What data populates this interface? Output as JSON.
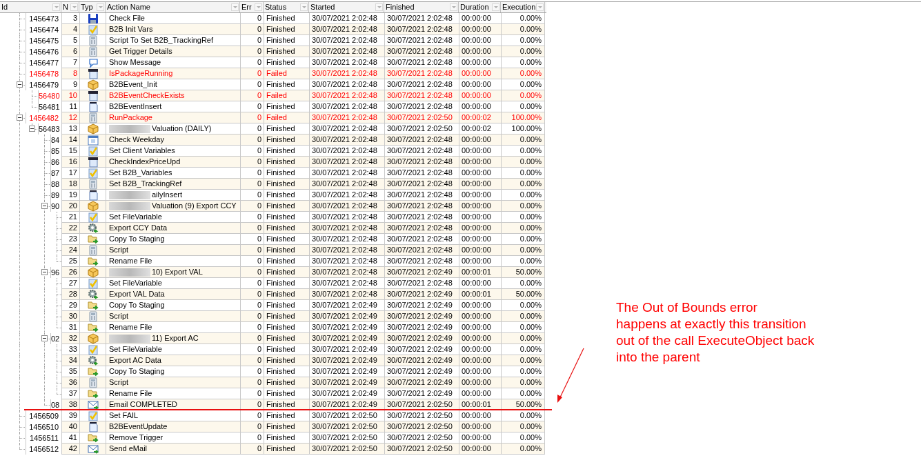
{
  "columns": [
    "Id",
    "N",
    "Typ",
    "Action Name",
    "Err",
    "Status",
    "Started",
    "Finished",
    "Duration",
    "Execution"
  ],
  "rows": [
    {
      "id": "1456473",
      "no": "3",
      "kind": "floppy",
      "name": "Check File",
      "errors": "0",
      "status": "Finished",
      "failed": false,
      "started": "30/07/2021 2:02:48",
      "finished": "30/07/2021 2:02:48",
      "duration": "00:00:00",
      "execution": "0.00%"
    },
    {
      "id": "1456474",
      "no": "4",
      "kind": "check",
      "name": "B2B Init Vars",
      "errors": "0",
      "status": "Finished",
      "failed": false,
      "started": "30/07/2021 2:02:48",
      "finished": "30/07/2021 2:02:48",
      "duration": "00:00:00",
      "execution": "0.00%"
    },
    {
      "id": "1456475",
      "no": "5",
      "kind": "calculator",
      "name": "Script To Set B2B_TrackingRef",
      "errors": "0",
      "status": "Finished",
      "failed": false,
      "started": "30/07/2021 2:02:48",
      "finished": "30/07/2021 2:02:48",
      "duration": "00:00:00",
      "execution": "0.00%"
    },
    {
      "id": "1456476",
      "no": "6",
      "kind": "calculator",
      "name": "Get Trigger Details",
      "errors": "0",
      "status": "Finished",
      "failed": false,
      "started": "30/07/2021 2:02:48",
      "finished": "30/07/2021 2:02:48",
      "duration": "00:00:00",
      "execution": "0.00%"
    },
    {
      "id": "1456477",
      "no": "7",
      "kind": "speech",
      "name": "Show Message",
      "errors": "0",
      "status": "Finished",
      "failed": false,
      "started": "30/07/2021 2:02:48",
      "finished": "30/07/2021 2:02:48",
      "duration": "00:00:00",
      "execution": "0.00%"
    },
    {
      "id": "1456478",
      "no": "8",
      "kind": "data",
      "name": "IsPackageRunning",
      "errors": "0",
      "status": "Failed",
      "failed": true,
      "started": "30/07/2021 2:02:48",
      "finished": "30/07/2021 2:02:48",
      "duration": "00:00:00",
      "execution": "0.00%"
    },
    {
      "id": "1456479",
      "no": "9",
      "kind": "box",
      "name": "B2BEvent_Init",
      "errors": "0",
      "status": "Finished",
      "failed": false,
      "started": "30/07/2021 2:02:48",
      "finished": "30/07/2021 2:02:48",
      "duration": "00:00:00",
      "execution": "0.00%",
      "expanded": true,
      "children": [
        {
          "id": "56480",
          "no": "10",
          "kind": "data",
          "name": "B2BEventCheckExists",
          "errors": "0",
          "status": "Failed",
          "failed": true,
          "started": "30/07/2021 2:02:48",
          "finished": "30/07/2021 2:02:48",
          "duration": "00:00:00",
          "execution": "0.00%"
        },
        {
          "id": "56481",
          "no": "11",
          "kind": "sql",
          "name": "B2BEventInsert",
          "errors": "0",
          "status": "Finished",
          "failed": false,
          "started": "30/07/2021 2:02:48",
          "finished": "30/07/2021 2:02:48",
          "duration": "00:00:00",
          "execution": "0.00%"
        }
      ]
    },
    {
      "id": "1456482",
      "no": "12",
      "kind": "calculator",
      "name": "RunPackage",
      "errors": "0",
      "status": "Failed",
      "failed": true,
      "started": "30/07/2021 2:02:48",
      "finished": "30/07/2021 2:02:50",
      "duration": "00:00:02",
      "execution": "100.00%",
      "expanded": true,
      "children": [
        {
          "id": "56483",
          "no": "13",
          "kind": "box",
          "name": "Valuation (DAILY)",
          "redacted": true,
          "errors": "0",
          "status": "Finished",
          "failed": false,
          "started": "30/07/2021 2:02:48",
          "finished": "30/07/2021 2:02:50",
          "duration": "00:00:02",
          "execution": "100.00%",
          "expanded": true,
          "children": [
            {
              "id": "84",
              "no": "14",
              "kind": "calendar",
              "name": "Check Weekday",
              "errors": "0",
              "status": "Finished",
              "failed": false,
              "started": "30/07/2021 2:02:48",
              "finished": "30/07/2021 2:02:48",
              "duration": "00:00:00",
              "execution": "0.00%"
            },
            {
              "id": "85",
              "no": "15",
              "kind": "check",
              "name": "Set Client Variables",
              "errors": "0",
              "status": "Finished",
              "failed": false,
              "started": "30/07/2021 2:02:48",
              "finished": "30/07/2021 2:02:48",
              "duration": "00:00:00",
              "execution": "0.00%"
            },
            {
              "id": "86",
              "no": "16",
              "kind": "data",
              "name": "CheckIndexPriceUpd",
              "errors": "0",
              "status": "Finished",
              "failed": false,
              "started": "30/07/2021 2:02:48",
              "finished": "30/07/2021 2:02:48",
              "duration": "00:00:00",
              "execution": "0.00%"
            },
            {
              "id": "87",
              "no": "17",
              "kind": "check",
              "name": "Set B2B_Variables",
              "errors": "0",
              "status": "Finished",
              "failed": false,
              "started": "30/07/2021 2:02:48",
              "finished": "30/07/2021 2:02:48",
              "duration": "00:00:00",
              "execution": "0.00%"
            },
            {
              "id": "88",
              "no": "18",
              "kind": "calculator",
              "name": "Set B2B_TrackingRef",
              "errors": "0",
              "status": "Finished",
              "failed": false,
              "started": "30/07/2021 2:02:48",
              "finished": "30/07/2021 2:02:48",
              "duration": "00:00:00",
              "execution": "0.00%"
            },
            {
              "id": "89",
              "no": "19",
              "kind": "sql",
              "name": "ailyInsert",
              "redacted": true,
              "errors": "0",
              "status": "Finished",
              "failed": false,
              "started": "30/07/2021 2:02:48",
              "finished": "30/07/2021 2:02:48",
              "duration": "00:00:00",
              "execution": "0.00%"
            },
            {
              "id": "90",
              "no": "20",
              "kind": "box",
              "name": "Valuation (9) Export CCY",
              "redacted": true,
              "errors": "0",
              "status": "Finished",
              "failed": false,
              "started": "30/07/2021 2:02:48",
              "finished": "30/07/2021 2:02:48",
              "duration": "00:00:00",
              "execution": "0.00%",
              "expanded": true,
              "children": [
                {
                  "no": "21",
                  "kind": "check",
                  "name": "Set FileVariable",
                  "errors": "0",
                  "status": "Finished",
                  "failed": false,
                  "started": "30/07/2021 2:02:48",
                  "finished": "30/07/2021 2:02:48",
                  "duration": "00:00:00",
                  "execution": "0.00%"
                },
                {
                  "no": "22",
                  "kind": "gear",
                  "name": "Export CCY Data",
                  "errors": "0",
                  "status": "Finished",
                  "failed": false,
                  "started": "30/07/2021 2:02:48",
                  "finished": "30/07/2021 2:02:48",
                  "duration": "00:00:00",
                  "execution": "0.00%"
                },
                {
                  "no": "23",
                  "kind": "folder",
                  "name": "Copy To Staging",
                  "errors": "0",
                  "status": "Finished",
                  "failed": false,
                  "started": "30/07/2021 2:02:48",
                  "finished": "30/07/2021 2:02:48",
                  "duration": "00:00:00",
                  "execution": "0.00%"
                },
                {
                  "no": "24",
                  "kind": "calculator",
                  "name": "Script",
                  "errors": "0",
                  "status": "Finished",
                  "failed": false,
                  "started": "30/07/2021 2:02:48",
                  "finished": "30/07/2021 2:02:48",
                  "duration": "00:00:00",
                  "execution": "0.00%"
                },
                {
                  "no": "25",
                  "kind": "folder",
                  "name": "Rename File",
                  "errors": "0",
                  "status": "Finished",
                  "failed": false,
                  "started": "30/07/2021 2:02:48",
                  "finished": "30/07/2021 2:02:48",
                  "duration": "00:00:00",
                  "execution": "0.00%"
                }
              ]
            },
            {
              "id": "96",
              "no": "26",
              "kind": "box",
              "name": "10) Export VAL",
              "redacted": true,
              "errors": "0",
              "status": "Finished",
              "failed": false,
              "started": "30/07/2021 2:02:48",
              "finished": "30/07/2021 2:02:49",
              "duration": "00:00:01",
              "execution": "50.00%",
              "expanded": true,
              "children": [
                {
                  "no": "27",
                  "kind": "check",
                  "name": "Set FileVariable",
                  "errors": "0",
                  "status": "Finished",
                  "failed": false,
                  "started": "30/07/2021 2:02:48",
                  "finished": "30/07/2021 2:02:48",
                  "duration": "00:00:00",
                  "execution": "0.00%"
                },
                {
                  "no": "28",
                  "kind": "gear",
                  "name": "Export VAL Data",
                  "errors": "0",
                  "status": "Finished",
                  "failed": false,
                  "started": "30/07/2021 2:02:48",
                  "finished": "30/07/2021 2:02:49",
                  "duration": "00:00:01",
                  "execution": "50.00%"
                },
                {
                  "no": "29",
                  "kind": "folder",
                  "name": "Copy To Staging",
                  "errors": "0",
                  "status": "Finished",
                  "failed": false,
                  "started": "30/07/2021 2:02:49",
                  "finished": "30/07/2021 2:02:49",
                  "duration": "00:00:00",
                  "execution": "0.00%"
                },
                {
                  "no": "30",
                  "kind": "calculator",
                  "name": "Script",
                  "errors": "0",
                  "status": "Finished",
                  "failed": false,
                  "started": "30/07/2021 2:02:49",
                  "finished": "30/07/2021 2:02:49",
                  "duration": "00:00:00",
                  "execution": "0.00%"
                },
                {
                  "no": "31",
                  "kind": "folder",
                  "name": "Rename File",
                  "errors": "0",
                  "status": "Finished",
                  "failed": false,
                  "started": "30/07/2021 2:02:49",
                  "finished": "30/07/2021 2:02:49",
                  "duration": "00:00:00",
                  "execution": "0.00%"
                }
              ]
            },
            {
              "id": "02",
              "no": "32",
              "kind": "box",
              "name": "11) Export AC",
              "redacted": true,
              "errors": "0",
              "status": "Finished",
              "failed": false,
              "started": "30/07/2021 2:02:49",
              "finished": "30/07/2021 2:02:49",
              "duration": "00:00:00",
              "execution": "0.00%",
              "expanded": true,
              "children": [
                {
                  "no": "33",
                  "kind": "check",
                  "name": "Set FileVariable",
                  "errors": "0",
                  "status": "Finished",
                  "failed": false,
                  "started": "30/07/2021 2:02:49",
                  "finished": "30/07/2021 2:02:49",
                  "duration": "00:00:00",
                  "execution": "0.00%"
                },
                {
                  "no": "34",
                  "kind": "gear",
                  "name": "Export AC Data",
                  "errors": "0",
                  "status": "Finished",
                  "failed": false,
                  "started": "30/07/2021 2:02:49",
                  "finished": "30/07/2021 2:02:49",
                  "duration": "00:00:00",
                  "execution": "0.00%"
                },
                {
                  "no": "35",
                  "kind": "folder",
                  "name": "Copy To Staging",
                  "errors": "0",
                  "status": "Finished",
                  "failed": false,
                  "started": "30/07/2021 2:02:49",
                  "finished": "30/07/2021 2:02:49",
                  "duration": "00:00:00",
                  "execution": "0.00%"
                },
                {
                  "no": "36",
                  "kind": "calculator",
                  "name": "Script",
                  "errors": "0",
                  "status": "Finished",
                  "failed": false,
                  "started": "30/07/2021 2:02:49",
                  "finished": "30/07/2021 2:02:49",
                  "duration": "00:00:00",
                  "execution": "0.00%"
                },
                {
                  "no": "37",
                  "kind": "folder",
                  "name": "Rename File",
                  "errors": "0",
                  "status": "Finished",
                  "failed": false,
                  "started": "30/07/2021 2:02:49",
                  "finished": "30/07/2021 2:02:49",
                  "duration": "00:00:00",
                  "execution": "0.00%"
                }
              ]
            },
            {
              "id": "08",
              "no": "38",
              "kind": "mail",
              "name": "Email COMPLETED",
              "errors": "0",
              "status": "Finished",
              "failed": false,
              "started": "30/07/2021 2:02:49",
              "finished": "30/07/2021 2:02:50",
              "duration": "00:00:01",
              "execution": "50.00%"
            }
          ]
        }
      ]
    },
    {
      "id": "1456509",
      "no": "39",
      "kind": "check",
      "name": "Set FAIL",
      "errors": "0",
      "status": "Finished",
      "failed": false,
      "started": "30/07/2021 2:02:50",
      "finished": "30/07/2021 2:02:50",
      "duration": "00:00:00",
      "execution": "0.00%"
    },
    {
      "id": "1456510",
      "no": "40",
      "kind": "sql",
      "name": "B2BEventUpdate",
      "errors": "0",
      "status": "Finished",
      "failed": false,
      "started": "30/07/2021 2:02:50",
      "finished": "30/07/2021 2:02:50",
      "duration": "00:00:00",
      "execution": "0.00%"
    },
    {
      "id": "1456511",
      "no": "41",
      "kind": "folder",
      "name": "Remove Trigger",
      "errors": "0",
      "status": "Finished",
      "failed": false,
      "started": "30/07/2021 2:02:50",
      "finished": "30/07/2021 2:02:50",
      "duration": "00:00:00",
      "execution": "0.00%"
    },
    {
      "id": "1456512",
      "no": "42",
      "kind": "mail",
      "name": "Send eMail",
      "errors": "0",
      "status": "Finished",
      "failed": false,
      "started": "30/07/2021 2:02:50",
      "finished": "30/07/2021 2:02:50",
      "duration": "00:00:00",
      "execution": "0.00%"
    }
  ],
  "annotation": {
    "lines": [
      "The Out of Bounds error",
      "happens at exactly this transition",
      "out of the call ExecuteObject back",
      "into the parent"
    ]
  }
}
